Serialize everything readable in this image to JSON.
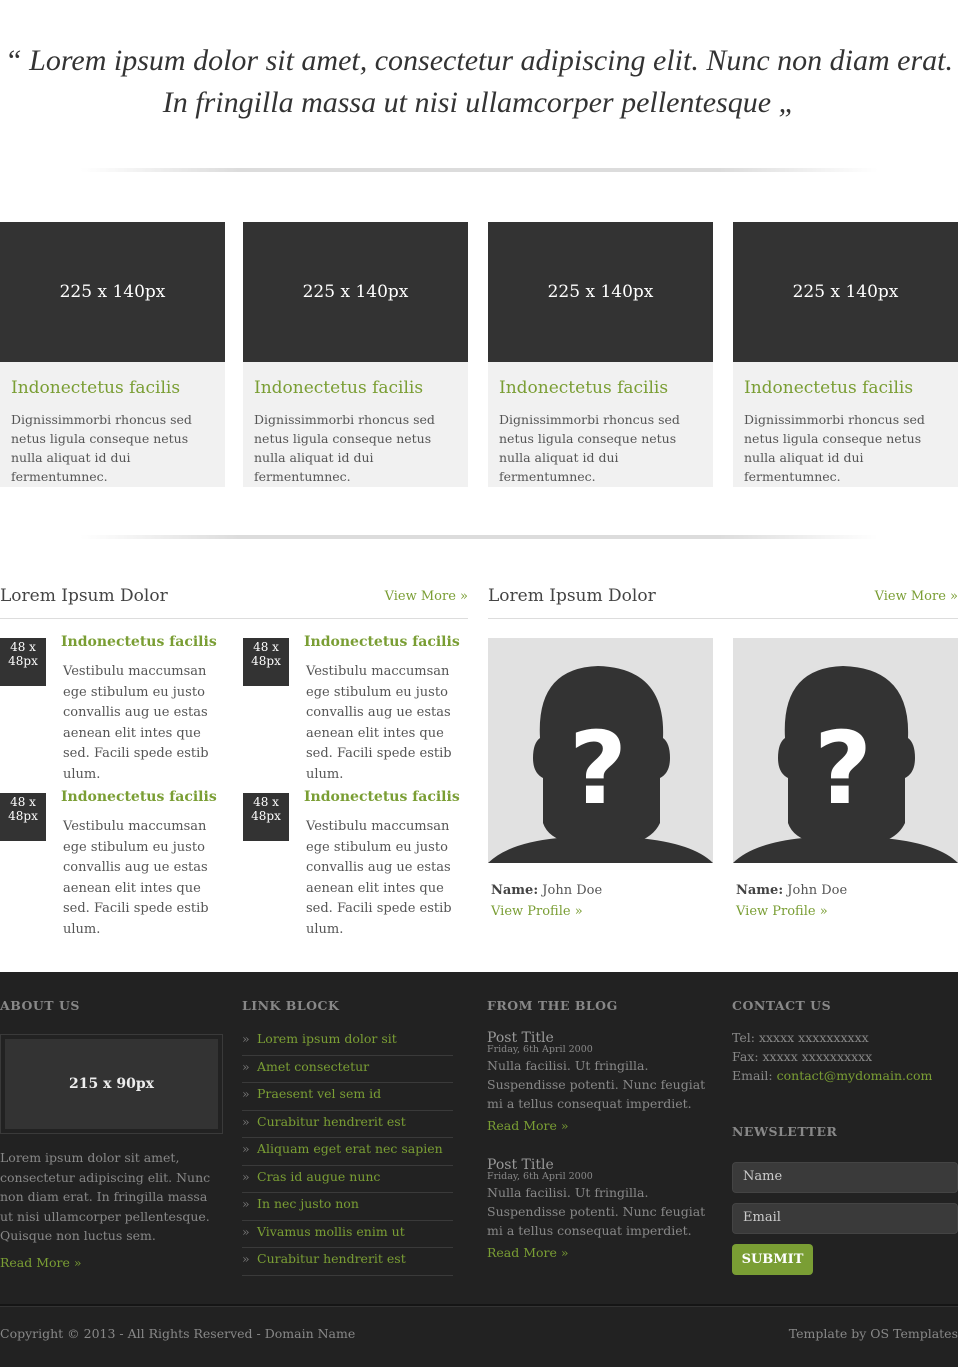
{
  "quote": "“ Lorem ipsum dolor sit amet, consectetur adipiscing elit. Nunc non diam erat. In fringilla massa ut nisi ullamcorper pellentesque „",
  "cards": [
    {
      "img": "225 x 140px",
      "title": "Indonectetus facilis",
      "text": "Dignissimmorbi rhoncus sed netus ligula conseque netus nulla aliquat id dui fermentumnec."
    },
    {
      "img": "225 x 140px",
      "title": "Indonectetus facilis",
      "text": "Dignissimmorbi rhoncus sed netus ligula conseque netus nulla aliquat id dui fermentumnec."
    },
    {
      "img": "225 x 140px",
      "title": "Indonectetus facilis",
      "text": "Dignissimmorbi rhoncus sed netus ligula conseque netus nulla aliquat id dui fermentumnec."
    },
    {
      "img": "225 x 140px",
      "title": "Indonectetus facilis",
      "text": "Dignissimmorbi rhoncus sed netus ligula conseque netus nulla aliquat id dui fermentumnec."
    }
  ],
  "left_section": {
    "title": "Lorem Ipsum Dolor",
    "more": "View More »",
    "items": [
      {
        "thumb": "48 x 48px",
        "title": "Indonectetus facilis",
        "text": "Vestibulu maccumsan ege stibulum eu justo convallis aug ue estas aenean elit intes que sed. Facili spede estib ulum."
      },
      {
        "thumb": "48 x 48px",
        "title": "Indonectetus facilis",
        "text": "Vestibulu maccumsan ege stibulum eu justo convallis aug ue estas aenean elit intes que sed. Facili spede estib ulum."
      },
      {
        "thumb": "48 x 48px",
        "title": "Indonectetus facilis",
        "text": "Vestibulu maccumsan ege stibulum eu justo convallis aug ue estas aenean elit intes que sed. Facili spede estib ulum."
      },
      {
        "thumb": "48 x 48px",
        "title": "Indonectetus facilis",
        "text": "Vestibulu maccumsan ege stibulum eu justo convallis aug ue estas aenean elit intes que sed. Facili spede estib ulum."
      }
    ]
  },
  "right_section": {
    "title": "Lorem Ipsum Dolor",
    "more": "View More »",
    "profiles": [
      {
        "name_label": "Name:",
        "name": "John Doe",
        "link": "View Profile »"
      },
      {
        "name_label": "Name:",
        "name": "John Doe",
        "link": "View Profile »"
      }
    ]
  },
  "footer": {
    "about": {
      "heading": "ABOUT US",
      "img": "215 x 90px",
      "text": "Lorem ipsum dolor sit amet, consectetur adipiscing elit. Nunc non diam erat. In fringilla massa ut nisi ullamcorper pellentesque. Quisque non luctus sem.",
      "read_more": "Read More »"
    },
    "links": {
      "heading": "LINK BLOCK",
      "items": [
        "Lorem ipsum dolor sit",
        "Amet consectetur",
        "Praesent vel sem id",
        "Curabitur hendrerit est",
        "Aliquam eget erat nec sapien",
        "Cras id augue nunc",
        "In nec justo non",
        "Vivamus mollis enim ut",
        "Curabitur hendrerit est"
      ]
    },
    "blog": {
      "heading": "FROM THE BLOG",
      "posts": [
        {
          "title": "Post Title",
          "date": "Friday, 6th April 2000",
          "text": "Nulla facilisi. Ut fringilla. Suspendisse potenti. Nunc feugiat mi a tellus consequat imperdiet.",
          "read_more": "Read More »"
        },
        {
          "title": "Post Title",
          "date": "Friday, 6th April 2000",
          "text": "Nulla facilisi. Ut fringilla. Suspendisse potenti. Nunc feugiat mi a tellus consequat imperdiet.",
          "read_more": "Read More »"
        }
      ]
    },
    "contact": {
      "heading": "CONTACT US",
      "tel": "Tel: xxxxx xxxxxxxxxx",
      "fax": "Fax: xxxxx xxxxxxxxxx",
      "email_label": "Email:",
      "email": "contact@mydomain.com"
    },
    "newsletter": {
      "heading": "NEWSLETTER",
      "name_placeholder": "Name",
      "email_placeholder": "Email",
      "submit": "SUBMIT"
    },
    "copyright": "Copyright © 2013 - All Rights Reserved - Domain Name",
    "credit": "Template by OS Templates"
  }
}
